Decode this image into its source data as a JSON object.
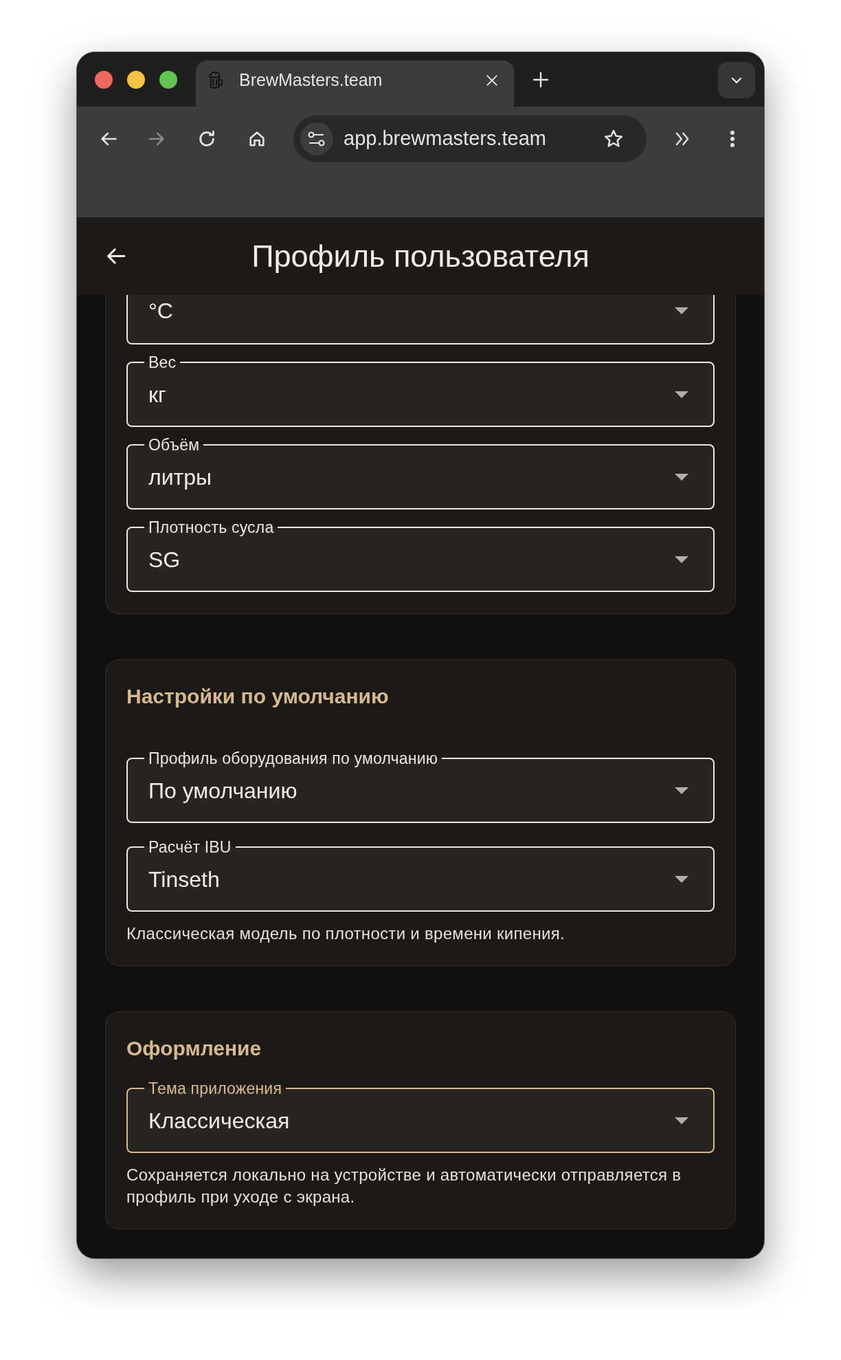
{
  "browser": {
    "tab": {
      "title": "BrewMasters.team",
      "selected": true
    },
    "address": "app.brewmasters.team"
  },
  "header": {
    "title": "Профиль пользователя"
  },
  "sections": [
    {
      "fields": [
        {
          "value": "°C",
          "focused": false
        },
        {
          "label": "Вес",
          "value": "кг",
          "focused": false
        },
        {
          "label": "Объём",
          "value": "литры",
          "focused": false
        },
        {
          "label": "Плотность сусла",
          "value": "SG",
          "focused": false
        }
      ]
    },
    {
      "title": "Настройки по умолчанию",
      "fields": [
        {
          "label": "Профиль оборудования по умолчанию",
          "value": "По умолчанию",
          "focused": false
        },
        {
          "label": "Расчёт IBU",
          "value": "Tinseth",
          "focused": false,
          "helper": "Классическая модель по плотности и времени кипения."
        }
      ]
    },
    {
      "title": "Оформление",
      "fields": [
        {
          "label": "Тема приложения",
          "value": "Классическая",
          "focused": true,
          "helper": "Сохраняется локально на устройстве и автоматически отправляется в профиль при уходе с экрана."
        }
      ]
    }
  ]
}
